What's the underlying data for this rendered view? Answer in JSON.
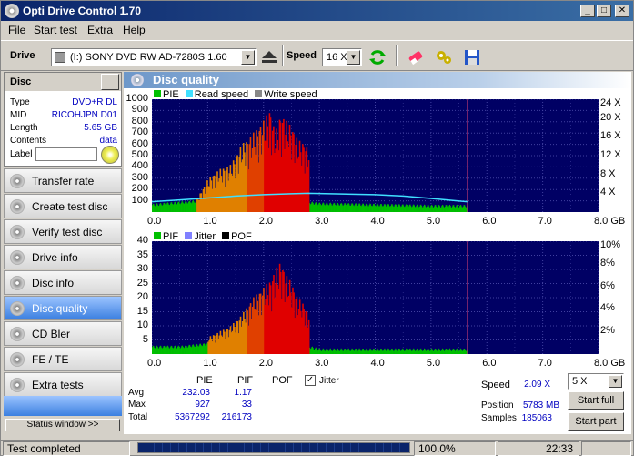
{
  "window": {
    "title": "Opti Drive Control 1.70"
  },
  "menu": [
    "File",
    "Start test",
    "Extra",
    "Help"
  ],
  "toolbar": {
    "drive_label": "Drive",
    "drive_value": "(I:)   SONY DVD RW AD-7280S 1.60",
    "speed_label": "Speed",
    "speed_value": "16 X"
  },
  "disc": {
    "header": "Disc",
    "fields": [
      {
        "key": "Type",
        "value": "DVD+R DL"
      },
      {
        "key": "MID",
        "value": "RICOHJPN D01"
      },
      {
        "key": "Length",
        "value": "5.65 GB"
      },
      {
        "key": "Contents",
        "value": "data"
      }
    ],
    "label_key": "Label"
  },
  "nav": [
    {
      "label": "Transfer rate",
      "active": false
    },
    {
      "label": "Create test disc",
      "active": false
    },
    {
      "label": "Verify test disc",
      "active": false
    },
    {
      "label": "Drive info",
      "active": false
    },
    {
      "label": "Disc info",
      "active": false
    },
    {
      "label": "Disc quality",
      "active": true
    },
    {
      "label": "CD Bler",
      "active": false
    },
    {
      "label": "FE / TE",
      "active": false
    },
    {
      "label": "Extra tests",
      "active": false
    }
  ],
  "status_window_btn": "Status window >>",
  "panel_title": "Disc quality",
  "legend_top": {
    "pie": "PIE",
    "read": "Read speed",
    "write": "Write speed"
  },
  "legend_bottom": {
    "pif": "PIF",
    "jitter": "Jitter",
    "pof": "POF"
  },
  "colors": {
    "plot_bg": "#000064",
    "pie_green": "#00c000",
    "spike_red": "#e00000",
    "read_cyan": "#40e0ff",
    "grid": "#4040a0"
  },
  "chart_data": [
    {
      "type": "area",
      "name": "PIE",
      "x_unit": "GB",
      "xlim": [
        0,
        8
      ],
      "ylim": [
        0,
        1000
      ],
      "y_ticks": [
        100,
        200,
        300,
        400,
        500,
        600,
        700,
        800,
        900,
        1000
      ],
      "y_ticks_right": [
        "4 X",
        "8 X",
        "12 X",
        "16 X",
        "20 X",
        "24 X"
      ],
      "x_ticks": [
        "0.0",
        "1.0",
        "2.0",
        "3.0",
        "4.0",
        "5.0",
        "6.0",
        "7.0",
        "8.0 GB"
      ],
      "baseline_series": {
        "x": [
          0,
          0.5,
          1.0,
          1.5,
          2.0,
          2.5,
          2.8,
          3.0,
          4.0,
          5.0,
          5.65
        ],
        "y": [
          50,
          70,
          90,
          60,
          80,
          70,
          70,
          60,
          50,
          40,
          40
        ]
      },
      "spike_series": {
        "x": [
          0.8,
          1.0,
          1.2,
          1.4,
          1.6,
          1.8,
          2.0,
          2.1,
          2.2,
          2.3,
          2.4,
          2.5,
          2.6,
          2.7,
          2.8
        ],
        "y": [
          120,
          300,
          380,
          420,
          600,
          700,
          820,
          920,
          700,
          880,
          810,
          760,
          640,
          620,
          560
        ]
      },
      "read_speed": {
        "x": [
          0,
          0.5,
          1.0,
          1.5,
          2.0,
          2.5,
          2.8,
          3.2,
          4.0,
          4.5,
          5.0,
          5.65
        ],
        "y": [
          2.2,
          2.6,
          3.0,
          3.4,
          3.7,
          3.9,
          4.0,
          3.9,
          3.7,
          3.4,
          2.9,
          2.2
        ]
      },
      "end_marker_gb": 5.65
    },
    {
      "type": "area",
      "name": "PIF",
      "x_unit": "GB",
      "xlim": [
        0,
        8
      ],
      "ylim": [
        0,
        40
      ],
      "y_ticks": [
        5,
        10,
        15,
        20,
        25,
        30,
        35,
        40
      ],
      "y_ticks_right": [
        "2%",
        "4%",
        "6%",
        "8%",
        "10%"
      ],
      "x_ticks": [
        "0.0",
        "1.0",
        "2.0",
        "3.0",
        "4.0",
        "5.0",
        "6.0",
        "7.0",
        "8.0 GB"
      ],
      "baseline_series": {
        "x": [
          0,
          0.5,
          1.0,
          1.5,
          2.0,
          2.5,
          2.8,
          3.0,
          4.0,
          5.0,
          5.65
        ],
        "y": [
          2,
          2,
          3,
          2,
          2,
          2,
          2,
          1,
          1,
          1,
          1
        ]
      },
      "spike_series": {
        "x": [
          1.0,
          1.2,
          1.4,
          1.6,
          1.8,
          2.0,
          2.1,
          2.2,
          2.3,
          2.4,
          2.5,
          2.6,
          2.7,
          2.8
        ],
        "y": [
          6,
          8,
          10,
          14,
          20,
          24,
          26,
          30,
          33,
          28,
          25,
          20,
          18,
          14
        ]
      },
      "end_marker_gb": 5.65
    }
  ],
  "stats": {
    "col_pie": "PIE",
    "col_pif": "PIF",
    "col_pof": "POF",
    "jitter_label": "Jitter",
    "rows": [
      {
        "label": "Avg",
        "pie": "232.03",
        "pif": "1.17"
      },
      {
        "label": "Max",
        "pie": "927",
        "pif": "33"
      },
      {
        "label": "Total",
        "pie": "5367292",
        "pif": "216173"
      }
    ]
  },
  "right_panel": {
    "speed_label": "Speed",
    "speed_value": "2.09 X",
    "speed_select": "5 X",
    "position_label": "Position",
    "position_value": "5783 MB",
    "samples_label": "Samples",
    "samples_value": "185063",
    "start_full": "Start full",
    "start_part": "Start part"
  },
  "statusbar": {
    "left": "Test completed",
    "percent": "100.0%",
    "time": "22:33",
    "progress": 1.0
  }
}
